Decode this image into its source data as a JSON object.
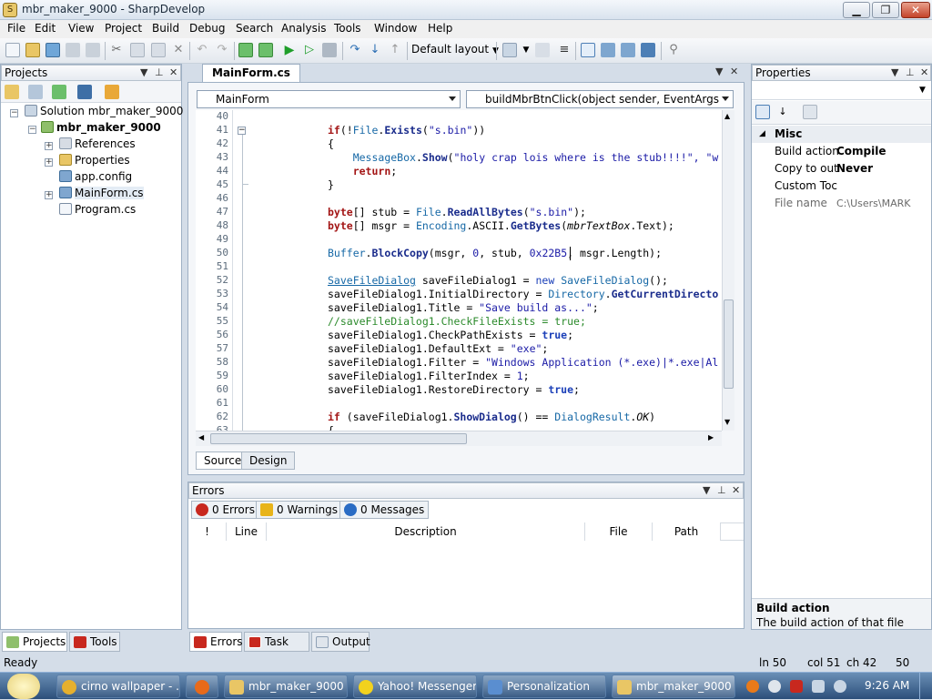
{
  "window": {
    "title": "mbr_maker_9000 - SharpDevelop",
    "min": "▁",
    "max": "❐",
    "close": "✕"
  },
  "menu": [
    "File",
    "Edit",
    "View",
    "Project",
    "Build",
    "Debug",
    "Search",
    "Analysis",
    "Tools",
    "Window",
    "Help"
  ],
  "toolbar": {
    "layout": "Default layout"
  },
  "projects": {
    "title": "Projects",
    "tree": [
      {
        "label": "Solution mbr_maker_9000",
        "bold": false
      },
      {
        "label": "mbr_maker_9000",
        "bold": true
      },
      {
        "label": "References",
        "bold": false
      },
      {
        "label": "Properties",
        "bold": false
      },
      {
        "label": "app.config",
        "bold": false
      },
      {
        "label": "MainForm.cs",
        "bold": false
      },
      {
        "label": "Program.cs",
        "bold": false
      }
    ],
    "tabs": [
      "Projects",
      "Tools"
    ]
  },
  "editor": {
    "tab": "MainForm.cs",
    "class_combo": "MainForm",
    "member_combo": "buildMbrBtnClick(object sender, EventArgs e)",
    "line_numbers": [
      "40",
      "41",
      "42",
      "43",
      "44",
      "45",
      "46",
      "47",
      "48",
      "49",
      "50",
      "51",
      "52",
      "53",
      "54",
      "55",
      "56",
      "57",
      "58",
      "59",
      "60",
      "61",
      "62",
      "63"
    ],
    "view_tabs": [
      "Source",
      "Design"
    ]
  },
  "errors": {
    "title": "Errors",
    "counts": [
      "0 Errors",
      "0 Warnings",
      "0 Messages"
    ],
    "columns": [
      "!",
      "Line",
      "Description",
      "File",
      "Path"
    ],
    "tabs": [
      "Errors",
      "Task List",
      "Output"
    ]
  },
  "properties": {
    "title": "Properties",
    "category": "Misc",
    "rows": [
      {
        "key": "Build action",
        "value": "Compile"
      },
      {
        "key": "Copy to out",
        "value": "Never"
      },
      {
        "key": "Custom Toc",
        "value": ""
      },
      {
        "key": "File name",
        "value": "C:\\Users\\MARK ZU("
      }
    ],
    "desc_title": "Build action",
    "desc_text": "The build action of that file"
  },
  "status": {
    "left": "Ready",
    "ln": "ln 50",
    "col": "col 51",
    "ch": "ch 42",
    "num": "50"
  },
  "taskbar": {
    "items": [
      "cirno wallpaper - ...",
      "mbr_maker_9000",
      "Yahoo! Messenger",
      "Personalization",
      "mbr_maker_9000 ..."
    ],
    "clock": "9:26 AM"
  },
  "colors": {
    "accent": "#2c4f7a",
    "error": "#c8281e",
    "warning": "#e8b41a",
    "info": "#2a6cc4"
  }
}
